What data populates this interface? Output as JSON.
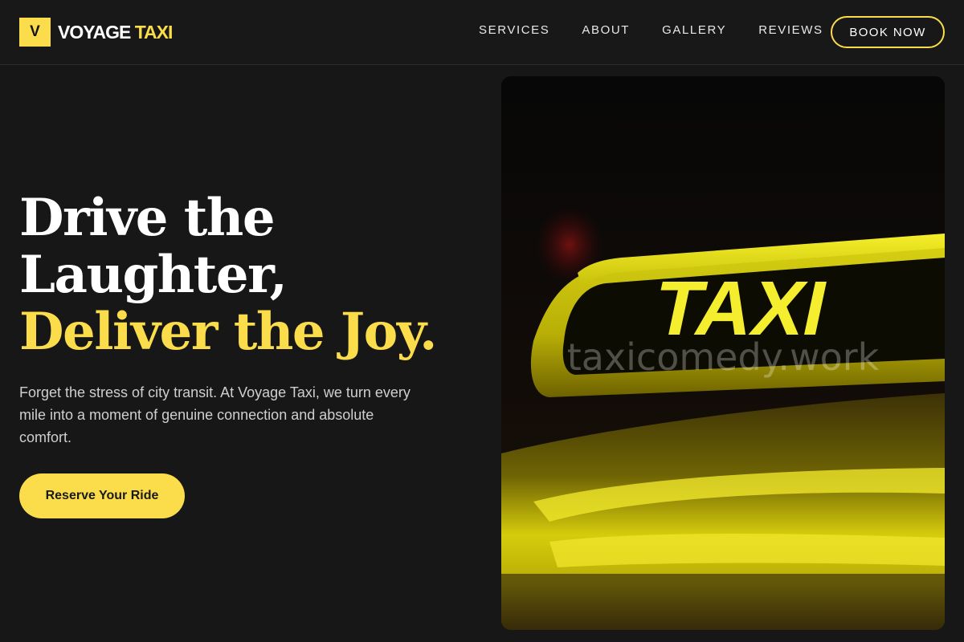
{
  "brand": {
    "mark": "V",
    "name_part1": "VOYAGE",
    "name_part2": "TAXI"
  },
  "nav": {
    "items": [
      {
        "label": "SERVICES"
      },
      {
        "label": "ABOUT"
      },
      {
        "label": "GALLERY"
      },
      {
        "label": "REVIEWS"
      }
    ],
    "cta_label": "BOOK NOW"
  },
  "hero": {
    "headline_line1": "Drive the",
    "headline_line2": "Laughter,",
    "headline_line3": "Deliver the Joy.",
    "description": "Forget the stress of city transit. At Voyage Taxi, we turn every mile into a moment of genuine connection and absolute comfort.",
    "cta_label": "Reserve Your Ride"
  },
  "image": {
    "sign_text": "TAXI",
    "watermark": "taxicomedy.work"
  },
  "colors": {
    "accent": "#fbdc4a",
    "background": "#171717",
    "text": "#ffffff",
    "muted_text": "#cfcfcf"
  }
}
